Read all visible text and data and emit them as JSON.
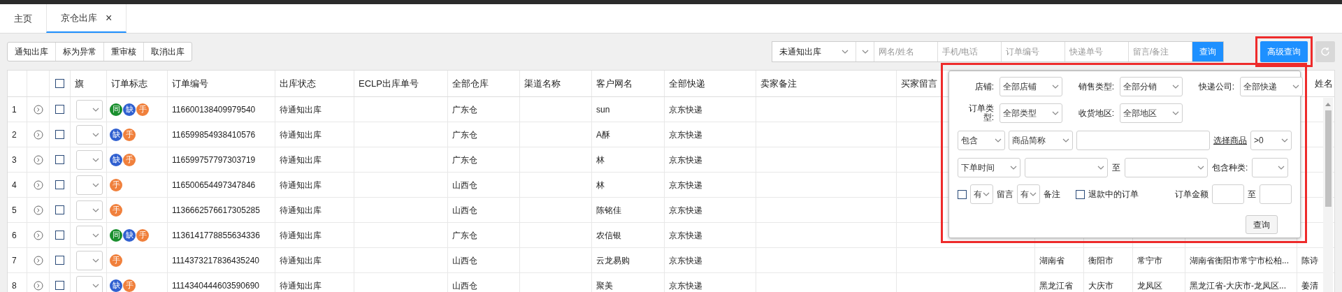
{
  "tabs": [
    {
      "label": "主页",
      "selected": false
    },
    {
      "label": "京仓出库",
      "selected": true,
      "close": "×"
    }
  ],
  "actions": [
    "通知出库",
    "标为异常",
    "重审核",
    "取消出库"
  ],
  "search": {
    "status": "未通知出库",
    "fields": [
      {
        "placeholder": "网名/姓名"
      },
      {
        "placeholder": "手机/电话"
      },
      {
        "placeholder": "订单编号"
      },
      {
        "placeholder": "快递单号"
      },
      {
        "placeholder": "留言/备注"
      }
    ],
    "query": "查询",
    "advanced": "高级查询",
    "advanced_highlighted": true
  },
  "header_checked": false,
  "columns": [
    "旗",
    "订单标志",
    "订单编号",
    "出库状态",
    "ECLP出库单号",
    "全部仓库",
    "渠道名称",
    "客户网名",
    "全部快递",
    "卖家备注",
    "买家留言",
    "姓名"
  ],
  "rows": [
    {
      "index": "1",
      "checked": false,
      "badges": [
        {
          "text": "同",
          "color": "#1a8f2e"
        },
        {
          "text": "缺",
          "color": "#3060d0"
        },
        {
          "text": "手",
          "color": "#f0803c"
        }
      ],
      "order_no": "116600138409979540",
      "status": "待通知出库",
      "warehouse": "广东仓",
      "customer": "sun",
      "express": "京东快递"
    },
    {
      "index": "2",
      "checked": false,
      "badges": [
        {
          "text": "缺",
          "color": "#3060d0"
        },
        {
          "text": "手",
          "color": "#f0803c"
        }
      ],
      "order_no": "116599854938410576",
      "status": "待通知出库",
      "warehouse": "广东仓",
      "customer": "A酥",
      "express": "京东快递"
    },
    {
      "index": "3",
      "checked": false,
      "badges": [
        {
          "text": "缺",
          "color": "#3060d0"
        },
        {
          "text": "手",
          "color": "#f0803c"
        }
      ],
      "order_no": "116599757797303719",
      "status": "待通知出库",
      "warehouse": "广东仓",
      "customer": "林",
      "express": "京东快递"
    },
    {
      "index": "4",
      "checked": false,
      "badges": [
        {
          "text": "手",
          "color": "#f0803c"
        }
      ],
      "order_no": "116500654497347846",
      "status": "待通知出库",
      "warehouse": "山西仓",
      "customer": "林",
      "express": "京东快递"
    },
    {
      "index": "5",
      "checked": false,
      "badges": [
        {
          "text": "手",
          "color": "#f0803c"
        }
      ],
      "order_no": "1136662576617305285",
      "status": "待通知出库",
      "warehouse": "山西仓",
      "customer": "陈铭佳",
      "express": "京东快递"
    },
    {
      "index": "6",
      "checked": false,
      "badges": [
        {
          "text": "同",
          "color": "#1a8f2e"
        },
        {
          "text": "缺",
          "color": "#3060d0"
        },
        {
          "text": "手",
          "color": "#f0803c"
        }
      ],
      "order_no": "1136141778855634336",
      "status": "待通知出库",
      "warehouse": "广东仓",
      "customer": "农信银",
      "express": "京东快递"
    },
    {
      "index": "7",
      "checked": false,
      "badges": [
        {
          "text": "手",
          "color": "#f0803c"
        }
      ],
      "order_no": "1114373217836435240",
      "status": "待通知出库",
      "warehouse": "山西仓",
      "customer": "云龙易购",
      "express": "京东快递",
      "province": "湖南省",
      "city": "衡阳市",
      "district": "常宁市",
      "address": "湖南省衡阳市常宁市松柏...",
      "name": "陈诗"
    },
    {
      "index": "8",
      "checked": false,
      "badges": [
        {
          "text": "缺",
          "color": "#3060d0"
        },
        {
          "text": "手",
          "color": "#f0803c"
        }
      ],
      "order_no": "1114340444603590690",
      "status": "待通知出库",
      "warehouse": "山西仓",
      "customer": "聚美",
      "express": "京东快递",
      "province": "黑龙江省",
      "city": "大庆市",
      "district": "龙凤区",
      "address": "黑龙江省-大庆市-龙凤区...",
      "name": "姜清"
    }
  ],
  "advanced_panel": {
    "highlighted": true,
    "row1": [
      {
        "label": "店铺:",
        "value": "全部店铺"
      },
      {
        "label": "销售类型:",
        "value": "全部分销"
      },
      {
        "label": "快递公司:",
        "value": "全部快递"
      }
    ],
    "row2": [
      {
        "label": "订单类型:",
        "value": "全部类型"
      },
      {
        "label": "收货地区:",
        "value": "全部地区"
      }
    ],
    "contains": "包含",
    "product_field": "商品简称",
    "choose_product": "选择商品",
    "quantity": ">0",
    "time_type": "下单时间",
    "to": "至",
    "kinds_label": "包含种类:",
    "message_checked": false,
    "message_has": "有",
    "message_label": "留言",
    "note_has": "有",
    "note_label": "备注",
    "refund_checked": false,
    "refund_label": "退款中的订单",
    "amount_label": "订单金额",
    "amount_to": "至",
    "query": "查询"
  }
}
